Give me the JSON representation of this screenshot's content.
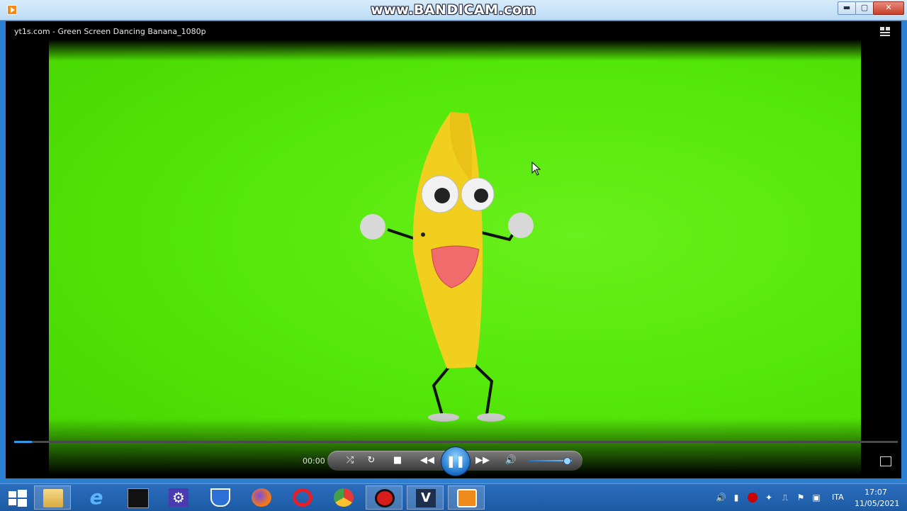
{
  "watermark": "www.BANDICAM.com",
  "window": {
    "minimize": "▬",
    "maximize": "▢",
    "close": "✕"
  },
  "player": {
    "video_title": "yt1s.com - Green Screen Dancing Banana_1080p",
    "time": "00:00",
    "progress": 0.02,
    "volume": 0.88
  },
  "controls": {
    "shuffle": "⤮",
    "repeat": "↻",
    "stop": "■",
    "prev": "◀◀",
    "play_pause": "❚❚",
    "next": "▶▶",
    "mute": "🔊"
  },
  "taskbar": {
    "items": [
      "file-explorer-icon",
      "internet-explorer-icon",
      "command-prompt-icon",
      "settings-icon",
      "windows-defender-icon",
      "firefox-icon",
      "opera-icon",
      "chrome-icon",
      "bandicam-record-icon",
      "vegas-icon",
      "media-player-icon"
    ],
    "language": "ITA",
    "clock_time": "17:07",
    "clock_date": "11/05/2021"
  },
  "colors": {
    "green_screen": "#55e80a",
    "taskbar": "#1d5aa3",
    "accent": "#2f9be6"
  }
}
